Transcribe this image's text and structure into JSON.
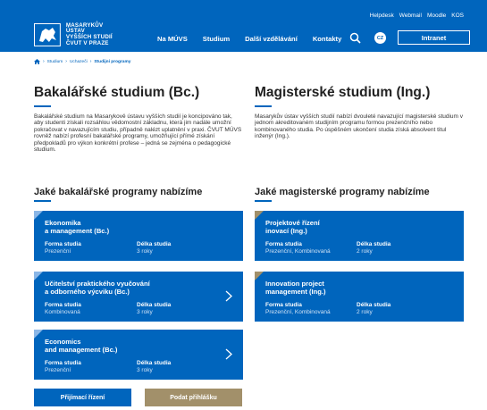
{
  "header": {
    "logo_lines": [
      "MASARYKŮV ÚSTAV",
      "VYŠŠÍCH STUDIÍ",
      "ČVUT V PRAZE"
    ],
    "top_links": [
      "Helpdesk",
      "Webmail",
      "Moodle",
      "KOS"
    ],
    "nav": [
      "Na MÚVS",
      "Studium",
      "Další vzdělávání",
      "Kontakty"
    ],
    "lang": "CZ",
    "intranet": "Intranet"
  },
  "breadcrumb": [
    "Studium",
    "Uchazeči",
    "Studijní programy"
  ],
  "bachelor": {
    "heading": "Bakalářské studium (Bc.)",
    "intro": "Bakalářské studium na Masarykově ústavu vyšších studií je koncipováno tak, aby studenti získali rozsáhlou vědomostní základnu, která jim nadále umožní pokračovat v navazujícím studiu, případně nalézt uplatnění v praxi. ČVUT MÚVS rovněž nabízí profesní bakalářské programy, umožňující přímé získání předpokladů pro výkon konkrétní profese – jedná se zejména o pedagogické studium.",
    "programs_heading": "Jaké bakalářské programy nabízíme",
    "programs": [
      {
        "title": [
          "Ekonomika",
          "a management (Bc.)"
        ],
        "form_label": "Forma studia",
        "form": "Prezenční",
        "length_label": "Délka studia",
        "length": "3 roky"
      },
      {
        "title": [
          "Učitelství praktického vyučování",
          "a odborného výcviku (Bc.)"
        ],
        "form_label": "Forma studia",
        "form": "Kombinovaná",
        "length_label": "Délka studia",
        "length": "3 roky"
      },
      {
        "title": [
          "Economics",
          "and management (Bc.)"
        ],
        "form_label": "Forma studia",
        "form": "Prezenční",
        "length_label": "Délka studia",
        "length": "3 roky"
      }
    ]
  },
  "master": {
    "heading": "Magisterské studium (Ing.)",
    "intro": "Masarykův ústav vyšších studií nabízí dvouleté navazující magisterské studium v jednom akreditovaném studijním programu formou prezenčního nebo kombinovaného studia. Po úspěšném ukončení studia získá absolvent titul inženýr (Ing.).",
    "programs_heading": "Jaké magisterské programy nabízíme",
    "programs": [
      {
        "title": [
          "Projektové řízení",
          "inovací (Ing.)"
        ],
        "form_label": "Forma studia",
        "form": "Prezenční, Kombinovaná",
        "length_label": "Délka studia",
        "length": "2 roky"
      },
      {
        "title": [
          "Innovation project",
          "management (Ing.)"
        ],
        "form_label": "Forma studia",
        "form": "Prezenční, Kombinovaná",
        "length_label": "Délka studia",
        "length": "2 roky"
      }
    ]
  },
  "buttons": {
    "admission": "Přijímací řízení",
    "apply": "Podat přihlášku"
  },
  "colors": {
    "primary": "#0065bd",
    "gold": "#a2906a",
    "bachelor_corner": "#8ab6e6",
    "master_corner": "#a2906a"
  }
}
